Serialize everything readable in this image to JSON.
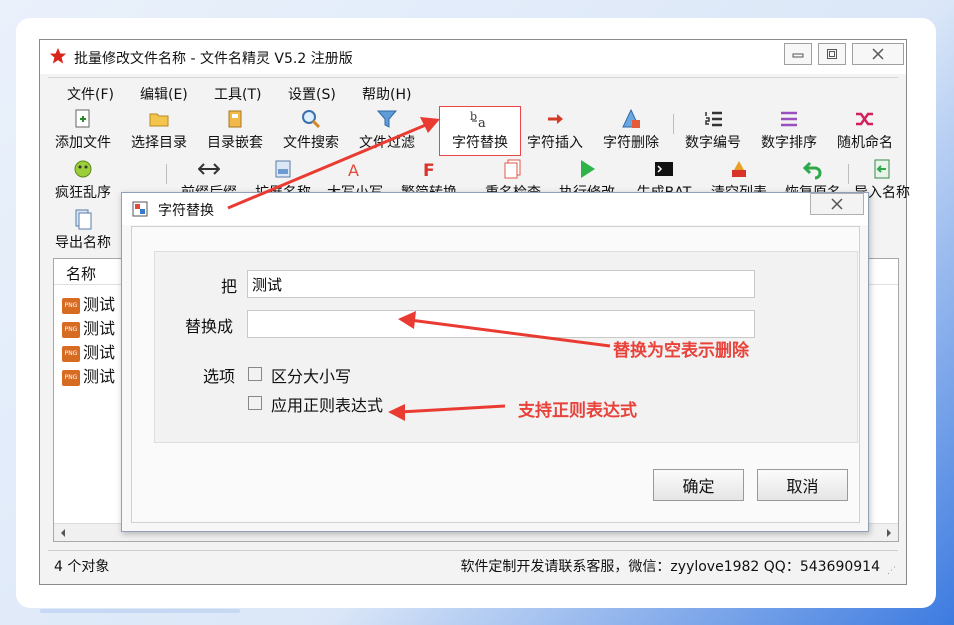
{
  "window": {
    "title": "批量修改文件名称 - 文件名精灵 V5.2 注册版",
    "controls": [
      "minimize",
      "restore",
      "close"
    ]
  },
  "menu": [
    "文件(F)",
    "编辑(E)",
    "工具(T)",
    "设置(S)",
    "帮助(H)"
  ],
  "toolbar": {
    "row1": [
      {
        "label": "添加文件",
        "icon": "add-file-icon"
      },
      {
        "label": "选择目录",
        "icon": "folder-icon"
      },
      {
        "label": "目录嵌套",
        "icon": "nested-folder-icon"
      },
      {
        "label": "文件搜索",
        "icon": "search-icon"
      },
      {
        "label": "文件过滤",
        "icon": "filter-icon"
      },
      {
        "label": "字符替换",
        "icon": "replace-icon"
      },
      {
        "label": "字符插入",
        "icon": "insert-icon"
      },
      {
        "label": "字符删除",
        "icon": "delete-char-icon"
      },
      {
        "label": "数字编号",
        "icon": "number-list-icon"
      },
      {
        "label": "数字排序",
        "icon": "sort-icon"
      },
      {
        "label": "随机命名",
        "icon": "shuffle-icon"
      }
    ],
    "row2": [
      {
        "label": "疯狂乱序",
        "icon": "crazy-icon"
      },
      {
        "label": "前缀后缀",
        "icon": "prefix-suffix-icon"
      },
      {
        "label": "扩展名称",
        "icon": "extension-icon"
      },
      {
        "label": "大写小写",
        "icon": "case-icon"
      },
      {
        "label": "繁简转换",
        "icon": "convert-icon"
      },
      {
        "label": "重名检查",
        "icon": "duplicate-check-icon"
      },
      {
        "label": "执行修改",
        "icon": "play-icon"
      },
      {
        "label": "生成BAT",
        "icon": "terminal-icon"
      },
      {
        "label": "清空列表",
        "icon": "clear-list-icon"
      },
      {
        "label": "恢复原名",
        "icon": "undo-icon"
      },
      {
        "label": "导入名称",
        "icon": "import-icon"
      }
    ],
    "row3": [
      {
        "label": "导出名称",
        "icon": "export-icon"
      }
    ]
  },
  "list": {
    "column": "名称",
    "rows": [
      "测试",
      "测试",
      "测试",
      "测试"
    ]
  },
  "status": {
    "count": "4 个对象",
    "contact": "软件定制开发请联系客服，微信：zyylove1982   QQ：543690914"
  },
  "dialog": {
    "title": "字符替换",
    "close": "☒",
    "find_label": "把",
    "find_value": "测试",
    "replace_label": "替换成",
    "replace_value": "",
    "options_label": "选项",
    "options": [
      {
        "label": "区分大小写",
        "checked": false
      },
      {
        "label": "应用正则表达式",
        "checked": false
      }
    ],
    "ok": "确定",
    "cancel": "取消"
  },
  "annotations": {
    "empty_delete": "替换为空表示删除",
    "regex_support": "支持正则表达式"
  },
  "colors": {
    "annotation": "#e9423b",
    "highlight_border": "#e84747"
  }
}
